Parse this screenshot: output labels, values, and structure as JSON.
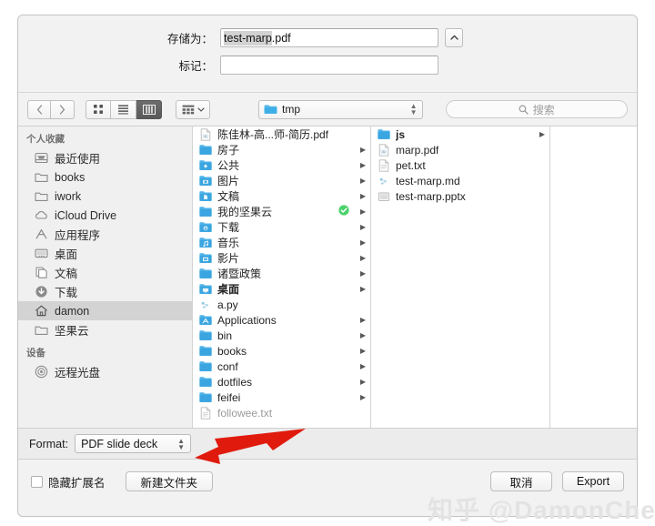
{
  "dialog": {
    "save_as_label": "存储为：",
    "save_as_value": "test-marp.pdf",
    "save_as_selected": "test-marp",
    "save_as_suffix": ".pdf",
    "tags_label": "标记：",
    "tags_value": "",
    "disclosure_icon": "chevron-up-icon"
  },
  "toolbar": {
    "back_icon": "chevron-left-icon",
    "forward_icon": "chevron-right-icon",
    "view_icon_label": "icon-view-icon",
    "view_list_label": "list-view-icon",
    "view_column_label": "column-view-icon",
    "arrange_label": "arrange-by-icon",
    "path_label": "tmp",
    "path_folder_icon": "blue-folder-icon",
    "search_placeholder": "搜索",
    "search_icon": "search-icon"
  },
  "sidebar": {
    "favorites_header": "个人收藏",
    "devices_header": "设备",
    "favorites": [
      {
        "label": "最近使用",
        "icon": "recents-icon",
        "selected": false
      },
      {
        "label": "books",
        "icon": "folder-outline-icon",
        "selected": false
      },
      {
        "label": "iwork",
        "icon": "folder-outline-icon",
        "selected": false
      },
      {
        "label": "iCloud Drive",
        "icon": "cloud-icon",
        "selected": false
      },
      {
        "label": "应用程序",
        "icon": "applications-icon",
        "selected": false
      },
      {
        "label": "桌面",
        "icon": "desktop-icon",
        "selected": false
      },
      {
        "label": "文稿",
        "icon": "documents-icon",
        "selected": false
      },
      {
        "label": "下载",
        "icon": "downloads-icon",
        "selected": false
      },
      {
        "label": "damon",
        "icon": "home-icon",
        "selected": true
      },
      {
        "label": "坚果云",
        "icon": "folder-outline-icon",
        "selected": false
      }
    ],
    "devices": [
      {
        "label": "远程光盘",
        "icon": "remote-disc-icon",
        "selected": false
      }
    ]
  },
  "columns": [
    {
      "name": "column-home",
      "rows": [
        {
          "label": "陈佳林-高...师-简历.pdf",
          "icon": "pdf-file-icon",
          "kind": "file",
          "arrow": false,
          "badge": false
        },
        {
          "label": "房子",
          "icon": "blue-folder-icon",
          "kind": "folder",
          "arrow": true,
          "badge": false
        },
        {
          "label": "公共",
          "icon": "public-folder-icon",
          "kind": "folder",
          "arrow": true,
          "badge": false
        },
        {
          "label": "图片",
          "icon": "pictures-folder-icon",
          "kind": "folder",
          "arrow": true,
          "badge": false
        },
        {
          "label": "文稿",
          "icon": "documents-folder-icon",
          "kind": "folder",
          "arrow": true,
          "badge": false
        },
        {
          "label": "我的坚果云",
          "icon": "blue-folder-icon",
          "kind": "folder",
          "arrow": true,
          "badge": true
        },
        {
          "label": "下载",
          "icon": "downloads-folder-icon",
          "kind": "folder",
          "arrow": true,
          "badge": false
        },
        {
          "label": "音乐",
          "icon": "music-folder-icon",
          "kind": "folder",
          "arrow": true,
          "badge": false
        },
        {
          "label": "影片",
          "icon": "movies-folder-icon",
          "kind": "folder",
          "arrow": true,
          "badge": false
        },
        {
          "label": "诸暨政策",
          "icon": "blue-folder-icon",
          "kind": "folder",
          "arrow": true,
          "badge": false
        },
        {
          "label": "桌面",
          "icon": "desktop-folder-icon",
          "kind": "folder",
          "arrow": true,
          "badge": false
        },
        {
          "label": "a.py",
          "icon": "script-file-icon",
          "kind": "file",
          "arrow": false,
          "badge": false
        },
        {
          "label": "Applications",
          "icon": "applications-folder-icon",
          "kind": "folder",
          "arrow": true,
          "badge": false
        },
        {
          "label": "bin",
          "icon": "blue-folder-icon",
          "kind": "folder",
          "arrow": true,
          "badge": false
        },
        {
          "label": "books",
          "icon": "blue-folder-icon",
          "kind": "folder",
          "arrow": true,
          "badge": false
        },
        {
          "label": "conf",
          "icon": "blue-folder-icon",
          "kind": "folder",
          "arrow": true,
          "badge": false
        },
        {
          "label": "dotfiles",
          "icon": "blue-folder-icon",
          "kind": "folder",
          "arrow": true,
          "badge": false
        },
        {
          "label": "feifei",
          "icon": "blue-folder-icon",
          "kind": "folder",
          "arrow": true,
          "badge": false
        },
        {
          "label": "followee.txt",
          "icon": "text-file-icon",
          "kind": "file",
          "arrow": false,
          "badge": false
        }
      ]
    },
    {
      "name": "column-tmp",
      "rows": [
        {
          "label": "js",
          "icon": "blue-folder-icon",
          "kind": "folder",
          "arrow": true,
          "badge": false
        },
        {
          "label": "marp.pdf",
          "icon": "pdf-file-icon",
          "kind": "file",
          "arrow": false,
          "badge": false
        },
        {
          "label": "pet.txt",
          "icon": "text-file-icon",
          "kind": "file",
          "arrow": false,
          "badge": false
        },
        {
          "label": "test-marp.md",
          "icon": "script-file-icon",
          "kind": "file",
          "arrow": false,
          "badge": false
        },
        {
          "label": "test-marp.pptx",
          "icon": "presentation-file-icon",
          "kind": "file",
          "arrow": false,
          "badge": false
        }
      ]
    },
    {
      "name": "column-preview",
      "rows": []
    }
  ],
  "format_bar": {
    "label": "Format:",
    "value": "PDF slide deck"
  },
  "bottom_bar": {
    "hide_extension_label": "隐藏扩展名",
    "hide_extension_checked": false,
    "new_folder_label": "新建文件夹",
    "cancel_label": "取消",
    "export_label": "Export"
  },
  "annotation": {
    "arrow_color": "#e01b0e",
    "points_to": "format-popup"
  },
  "watermark": {
    "text": "知乎 @DamonChen"
  }
}
